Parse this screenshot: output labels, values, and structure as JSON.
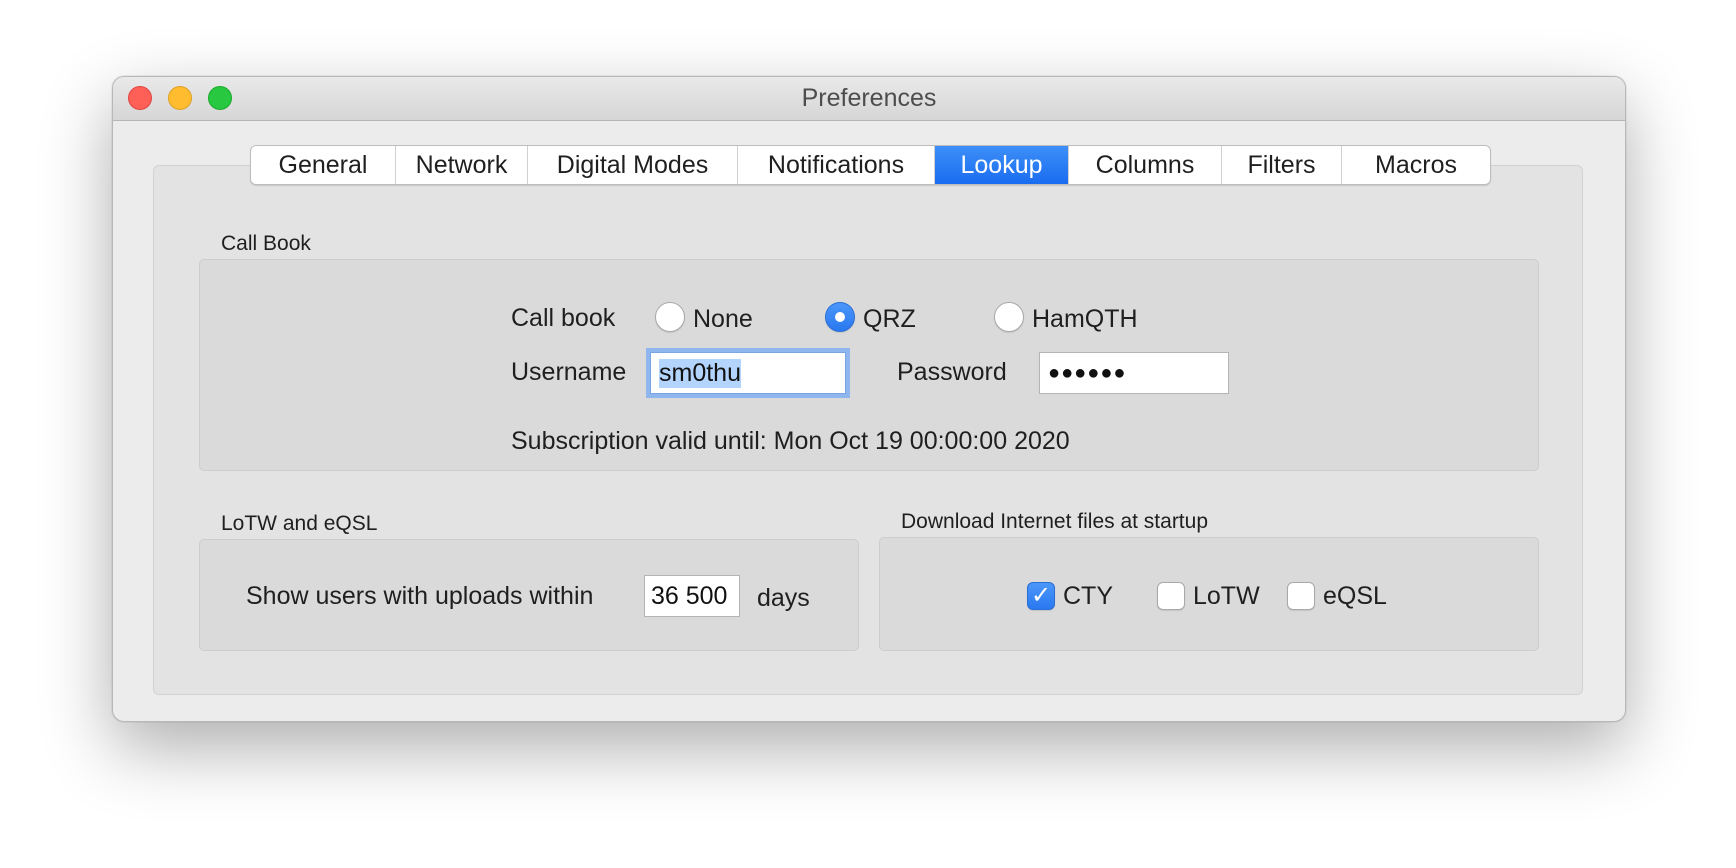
{
  "window": {
    "title": "Preferences"
  },
  "tabs": [
    {
      "label": "General",
      "active": false
    },
    {
      "label": "Network",
      "active": false
    },
    {
      "label": "Digital Modes",
      "active": false
    },
    {
      "label": "Notifications",
      "active": false
    },
    {
      "label": "Lookup",
      "active": true
    },
    {
      "label": "Columns",
      "active": false
    },
    {
      "label": "Filters",
      "active": false
    },
    {
      "label": "Macros",
      "active": false
    }
  ],
  "callbook": {
    "group_label": "Call Book",
    "label": "Call book",
    "options": [
      {
        "label": "None",
        "selected": false
      },
      {
        "label": "QRZ",
        "selected": true
      },
      {
        "label": "HamQTH",
        "selected": false
      }
    ],
    "username_label": "Username",
    "username_value": "sm0thu",
    "password_label": "Password",
    "password_value": "●●●●●●",
    "subscription_text": "Subscription valid until: Mon Oct 19 00:00:00 2020"
  },
  "lotw": {
    "group_label": "LoTW and eQSL",
    "label": "Show users with uploads within",
    "days_value": "36 500",
    "unit": "days"
  },
  "downloads": {
    "group_label": "Download Internet files at startup",
    "items": [
      {
        "label": "CTY",
        "checked": true
      },
      {
        "label": "LoTW",
        "checked": false
      },
      {
        "label": "eQSL",
        "checked": false
      }
    ]
  },
  "colors": {
    "accent": "#2a78f1",
    "selection": "#b3d4fc",
    "close": "#fe5f57",
    "minimize": "#febc2e",
    "maximize": "#28c840"
  }
}
